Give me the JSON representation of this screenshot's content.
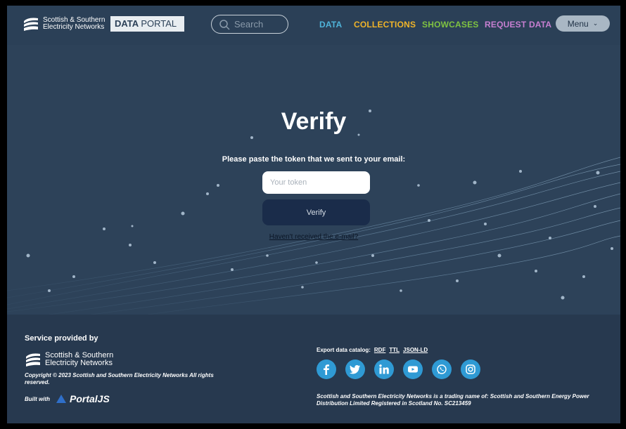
{
  "header": {
    "brand_line1": "Scottish & Southern",
    "brand_line2": "Electricity Networks",
    "portal_bold": "DATA",
    "portal_light": "PORTAL",
    "search_placeholder": "Search",
    "nav": {
      "data": "DATA",
      "collections": "COLLECTIONS",
      "showcases": "SHOWCASES",
      "request_data": "REQUEST DATA"
    },
    "menu_label": "Menu"
  },
  "main": {
    "title": "Verify",
    "prompt": "Please paste the token that we sent to your email:",
    "token_placeholder": "Your token",
    "token_value": "",
    "verify_label": "Verify",
    "resend_link": "Haven't received the e-mail?"
  },
  "footer": {
    "service_title": "Service provided by",
    "brand_line1": "Scottish & Southern",
    "brand_line2": "Electricity Networks",
    "copyright": "Copyright © 2023 Scottish and Southern Electricity Networks All rights reserved.",
    "built_with": "Built with",
    "portaljs": "PortalJS",
    "export_label": "Export data catalog:",
    "export_links": [
      "RDF",
      "TTL",
      "JSON-LD"
    ],
    "socials": [
      "facebook-icon",
      "twitter-icon",
      "linkedin-icon",
      "youtube-icon",
      "whatsapp-icon",
      "instagram-icon"
    ],
    "legal": "Scottish and Southern Electricity Networks is a trading name of: Scottish and Southern Energy Power Distribution Limited Registered in Scotland No. SC213459"
  },
  "colors": {
    "background": "#2b4057",
    "nav_data": "#4fb3d9",
    "nav_collections": "#f0b429",
    "nav_showcases": "#7fc241",
    "nav_request": "#c77fd1",
    "button": "#1a2c4a",
    "social": "#2f9ad4"
  }
}
